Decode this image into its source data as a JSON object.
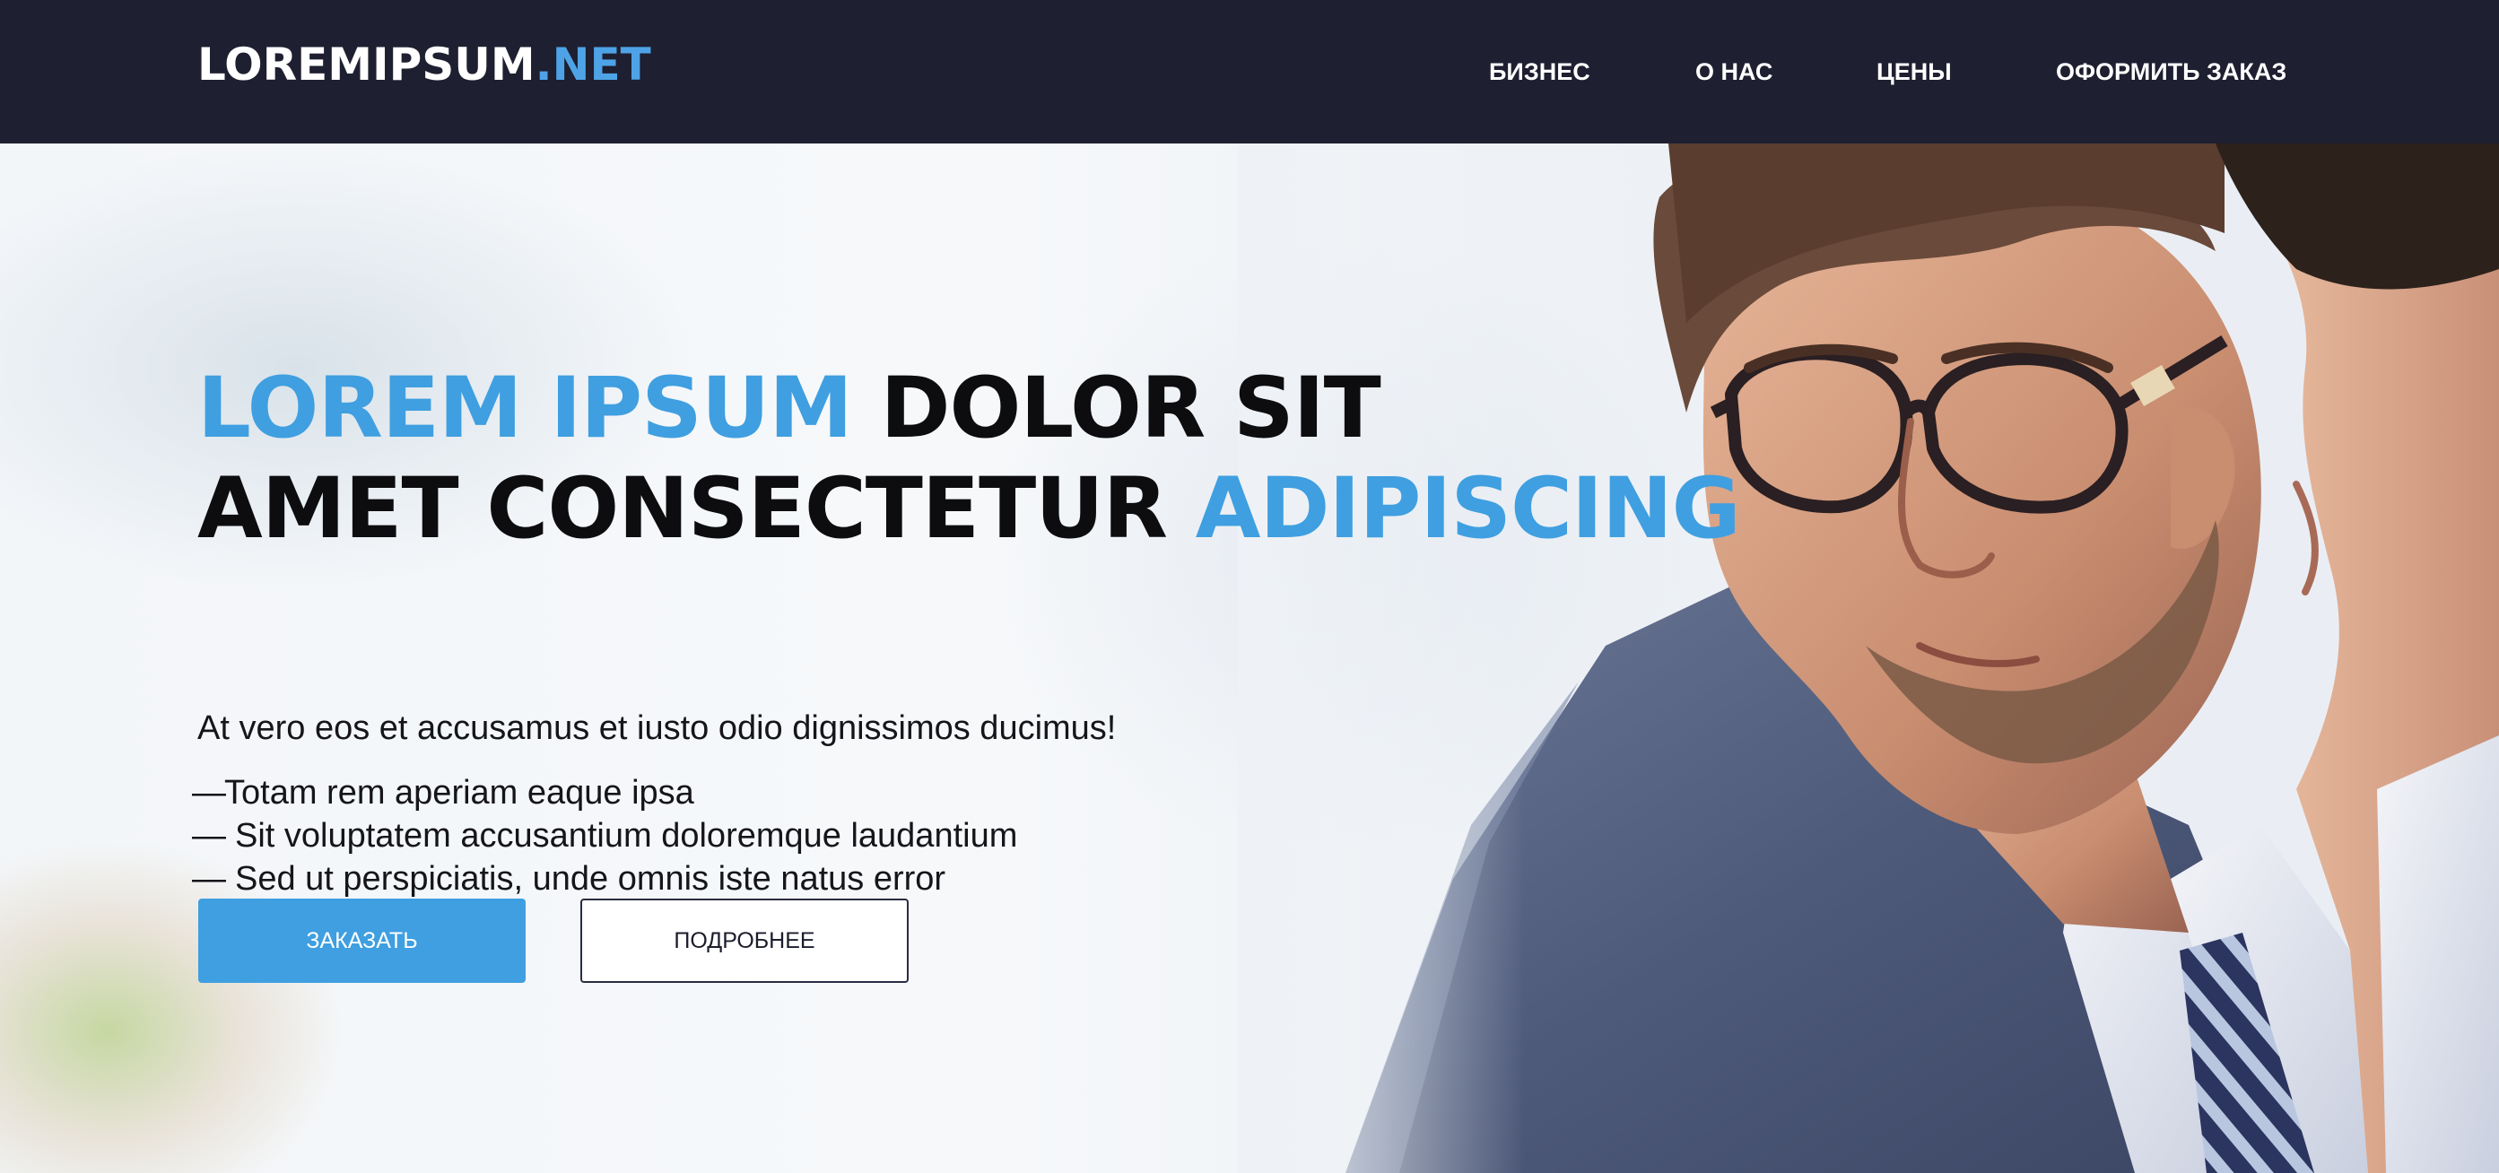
{
  "header": {
    "logo": {
      "main": "LOREMIPSUM",
      "dot": ".",
      "tld": "NET"
    },
    "nav": [
      {
        "label": "БИЗНЕС"
      },
      {
        "label": "О НАС"
      },
      {
        "label": "ЦЕНЫ"
      },
      {
        "label": "ОФОРМИТЬ ЗАКАЗ"
      }
    ]
  },
  "hero": {
    "headline": {
      "line1_accent": "LOREM IPSUM",
      "line1_rest": " DOLOR SIT",
      "line2_rest": "AMET CONSECTETUR ",
      "line2_accent": "ADIPISCING"
    },
    "intro": "At vero eos et accusamus et iusto odio dignissimos ducimus!",
    "bullets": [
      {
        "dash": "—",
        "text": "Totam rem aperiam eaque ipsa"
      },
      {
        "dash": "—",
        "text": "Sit voluptatem accusantium doloremque laudantium"
      },
      {
        "dash": "—",
        "text": "Sed ut perspiciatis, unde omnis iste natus error"
      }
    ],
    "buttons": {
      "primary": "ЗАКАЗАТЬ",
      "secondary": "ПОДРОБНЕЕ"
    }
  },
  "colors": {
    "navbar_bg": "#1e1f30",
    "accent": "#3f9fe0",
    "text_dark": "#0d0d10"
  },
  "images": {
    "hero_photo": "businessmen-with-glasses-photo"
  }
}
